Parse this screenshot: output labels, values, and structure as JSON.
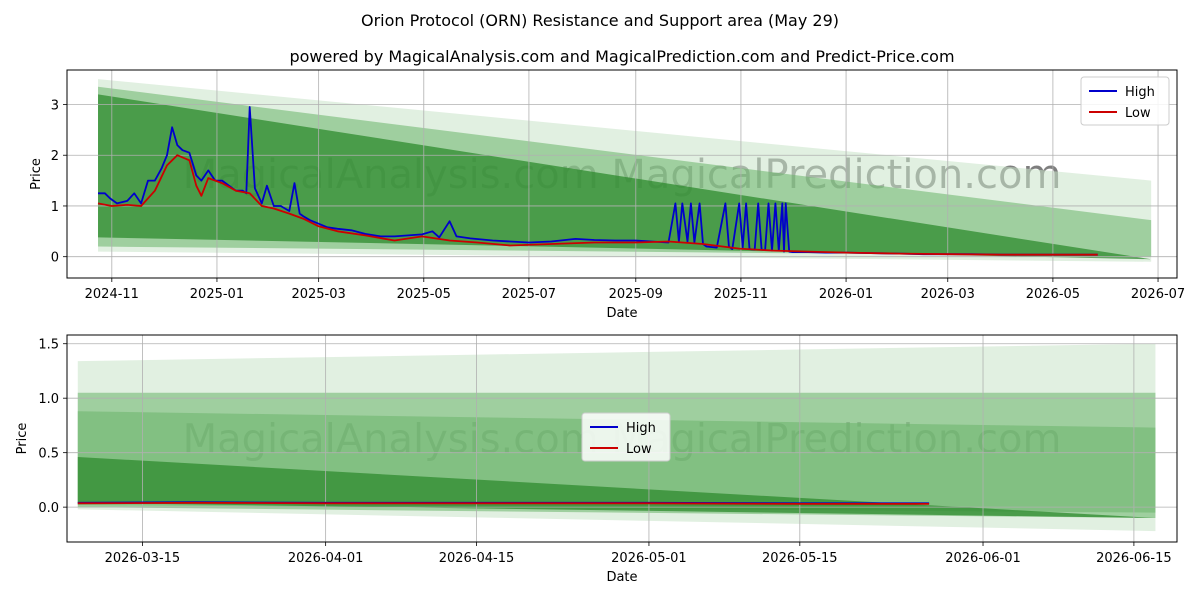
{
  "title": "Orion Protocol (ORN) Resistance and Support area (May 29)",
  "subtitle": "powered by MagicalAnalysis.com and MagicalPrediction.com and Predict-Price.com",
  "watermarks": [
    "MagicalAnalysis.com",
    "MagicalPrediction.com"
  ],
  "colors": {
    "high": "#0000cc",
    "low": "#cc0000",
    "band_dark": "#2e8b2e",
    "band_mid": "#6ab46a",
    "band_light": "#c8e4c8"
  },
  "chart_data": [
    {
      "type": "line",
      "xlabel": "Date",
      "ylabel": "Price",
      "x_ticks": [
        "2024-11",
        "2025-01",
        "2025-03",
        "2025-05",
        "2025-07",
        "2025-09",
        "2025-11",
        "2026-01",
        "2026-03",
        "2026-05",
        "2026-07"
      ],
      "y_ticks": [
        "0",
        "1",
        "2",
        "3"
      ],
      "xlim": [
        "2024-10-06",
        "2026-07-12"
      ],
      "ylim": [
        -0.42,
        3.68
      ],
      "grid": true,
      "legend": {
        "position": "top-right",
        "entries": [
          "High",
          "Low"
        ]
      },
      "series": [
        {
          "name": "High",
          "x": [
            "2024-10-24",
            "2024-10-28",
            "2024-10-31",
            "2024-11-04",
            "2024-11-10",
            "2024-11-14",
            "2024-11-18",
            "2024-11-22",
            "2024-11-26",
            "2024-11-30",
            "2024-12-03",
            "2024-12-06",
            "2024-12-09",
            "2024-12-12",
            "2024-12-16",
            "2024-12-20",
            "2024-12-23",
            "2024-12-27",
            "2024-12-31",
            "2025-01-04",
            "2025-01-08",
            "2025-01-12",
            "2025-01-16",
            "2025-01-18",
            "2025-01-20",
            "2025-01-23",
            "2025-01-27",
            "2025-01-30",
            "2025-02-03",
            "2025-02-07",
            "2025-02-12",
            "2025-02-15",
            "2025-02-18",
            "2025-02-20",
            "2025-02-24",
            "2025-03-01",
            "2025-03-06",
            "2025-03-12",
            "2025-03-20",
            "2025-03-28",
            "2025-04-06",
            "2025-04-14",
            "2025-04-22",
            "2025-04-30",
            "2025-05-06",
            "2025-05-10",
            "2025-05-16",
            "2025-05-20",
            "2025-05-28",
            "2025-06-10",
            "2025-06-20",
            "2025-07-01",
            "2025-07-14",
            "2025-07-28",
            "2025-08-08",
            "2025-08-20",
            "2025-09-01",
            "2025-09-10",
            "2025-09-20",
            "2025-09-24",
            "2025-09-26",
            "2025-09-28",
            "2025-10-01",
            "2025-10-03",
            "2025-10-05",
            "2025-10-08",
            "2025-10-10",
            "2025-10-12",
            "2025-10-18",
            "2025-10-23",
            "2025-10-25",
            "2025-10-27",
            "2025-10-31",
            "2025-11-02",
            "2025-11-04",
            "2025-11-06",
            "2025-11-09",
            "2025-11-11",
            "2025-11-13",
            "2025-11-15",
            "2025-11-17",
            "2025-11-19",
            "2025-11-21",
            "2025-11-23",
            "2025-11-25",
            "2025-11-26",
            "2025-11-27",
            "2025-11-29",
            "2025-12-01",
            "2025-12-10",
            "2025-12-20",
            "2026-01-01",
            "2026-01-15",
            "2026-02-01",
            "2026-02-15",
            "2026-03-01",
            "2026-03-15",
            "2026-04-01",
            "2026-04-15",
            "2026-05-01",
            "2026-05-15",
            "2026-05-27"
          ],
          "values": [
            1.25,
            1.25,
            1.15,
            1.05,
            1.1,
            1.25,
            1.05,
            1.5,
            1.5,
            1.75,
            2.0,
            2.55,
            2.2,
            2.1,
            2.05,
            1.6,
            1.5,
            1.7,
            1.5,
            1.5,
            1.4,
            1.3,
            1.3,
            1.25,
            2.95,
            1.35,
            1.05,
            1.4,
            1.0,
            1.0,
            0.9,
            1.45,
            0.85,
            0.8,
            0.72,
            0.65,
            0.58,
            0.55,
            0.52,
            0.45,
            0.4,
            0.4,
            0.42,
            0.44,
            0.5,
            0.38,
            0.7,
            0.4,
            0.36,
            0.32,
            0.3,
            0.28,
            0.3,
            0.35,
            0.33,
            0.32,
            0.32,
            0.3,
            0.28,
            1.05,
            0.3,
            1.05,
            0.3,
            1.05,
            0.28,
            1.05,
            0.25,
            0.2,
            0.18,
            1.05,
            0.2,
            0.15,
            1.05,
            0.18,
            1.05,
            0.15,
            0.14,
            1.05,
            0.14,
            0.13,
            1.05,
            0.12,
            1.05,
            0.12,
            1.05,
            0.1,
            1.05,
            0.1,
            0.09,
            0.09,
            0.08,
            0.08,
            0.07,
            0.06,
            0.05,
            0.05,
            0.05,
            0.04,
            0.04,
            0.04,
            0.04,
            0.04
          ]
        },
        {
          "name": "Low",
          "x": [
            "2024-10-24",
            "2024-11-01",
            "2024-11-10",
            "2024-11-18",
            "2024-11-26",
            "2024-12-03",
            "2024-12-09",
            "2024-12-16",
            "2024-12-20",
            "2024-12-23",
            "2024-12-27",
            "2025-01-04",
            "2025-01-12",
            "2025-01-20",
            "2025-01-27",
            "2025-02-03",
            "2025-02-12",
            "2025-02-20",
            "2025-03-01",
            "2025-03-12",
            "2025-03-28",
            "2025-04-14",
            "2025-04-30",
            "2025-05-16",
            "2025-06-01",
            "2025-06-20",
            "2025-07-14",
            "2025-08-08",
            "2025-09-01",
            "2025-09-20",
            "2025-10-10",
            "2025-10-31",
            "2025-11-20",
            "2025-12-10",
            "2026-01-01",
            "2026-02-01",
            "2026-03-01",
            "2026-04-01",
            "2026-05-01",
            "2026-05-27"
          ],
          "values": [
            1.05,
            1.0,
            1.02,
            1.0,
            1.3,
            1.8,
            2.0,
            1.9,
            1.4,
            1.2,
            1.55,
            1.45,
            1.3,
            1.25,
            1.0,
            0.95,
            0.85,
            0.75,
            0.6,
            0.5,
            0.42,
            0.32,
            0.4,
            0.32,
            0.28,
            0.22,
            0.25,
            0.28,
            0.28,
            0.3,
            0.25,
            0.16,
            0.12,
            0.1,
            0.08,
            0.06,
            0.05,
            0.04,
            0.04,
            0.04
          ]
        }
      ],
      "bands": [
        {
          "x": [
            "2024-10-24",
            "2026-06-27"
          ],
          "upper": [
            3.5,
            1.5
          ],
          "lower": [
            0.1,
            -0.1
          ],
          "shade": "light"
        },
        {
          "x": [
            "2024-10-24",
            "2026-06-27"
          ],
          "upper": [
            3.35,
            0.72
          ],
          "lower": [
            0.2,
            0.0
          ],
          "shade": "mid"
        },
        {
          "x": [
            "2024-10-24",
            "2026-06-27"
          ],
          "upper": [
            3.2,
            -0.05
          ],
          "lower": [
            0.38,
            -0.05
          ],
          "shade": "dark"
        }
      ]
    },
    {
      "type": "line",
      "xlabel": "Date",
      "ylabel": "Price",
      "x_ticks": [
        "2026-03-15",
        "2026-04-01",
        "2026-04-15",
        "2026-05-01",
        "2026-05-15",
        "2026-06-01",
        "2026-06-15"
      ],
      "y_ticks": [
        "0.0",
        "0.5",
        "1.0",
        "1.5"
      ],
      "xlim": [
        "2026-03-08",
        "2026-06-19"
      ],
      "ylim": [
        -0.32,
        1.58
      ],
      "grid": true,
      "legend": {
        "position": "center",
        "entries": [
          "High",
          "Low"
        ]
      },
      "series": [
        {
          "name": "High",
          "x": [
            "2026-03-09",
            "2026-03-20",
            "2026-04-01",
            "2026-04-15",
            "2026-05-01",
            "2026-05-15",
            "2026-05-27"
          ],
          "values": [
            0.04,
            0.045,
            0.04,
            0.04,
            0.04,
            0.035,
            0.035
          ]
        },
        {
          "name": "Low",
          "x": [
            "2026-03-09",
            "2026-03-20",
            "2026-04-01",
            "2026-04-15",
            "2026-05-01",
            "2026-05-15",
            "2026-05-27"
          ],
          "values": [
            0.035,
            0.04,
            0.035,
            0.035,
            0.035,
            0.03,
            0.03
          ]
        }
      ],
      "bands": [
        {
          "x": [
            "2026-03-09",
            "2026-06-17"
          ],
          "upper": [
            1.34,
            1.5
          ],
          "lower": [
            -0.02,
            -0.22
          ],
          "shade": "light"
        },
        {
          "x": [
            "2026-03-09",
            "2026-06-17"
          ],
          "upper": [
            1.05,
            1.05
          ],
          "lower": [
            0.0,
            -0.1
          ],
          "shade": "mid"
        },
        {
          "x": [
            "2026-03-09",
            "2026-06-17"
          ],
          "upper": [
            0.88,
            0.73
          ],
          "lower": [
            0.02,
            -0.05
          ],
          "shade": "mid"
        },
        {
          "x": [
            "2026-03-09",
            "2026-06-17"
          ],
          "upper": [
            0.46,
            -0.1
          ],
          "lower": [
            0.04,
            -0.1
          ],
          "shade": "dark"
        }
      ]
    }
  ]
}
